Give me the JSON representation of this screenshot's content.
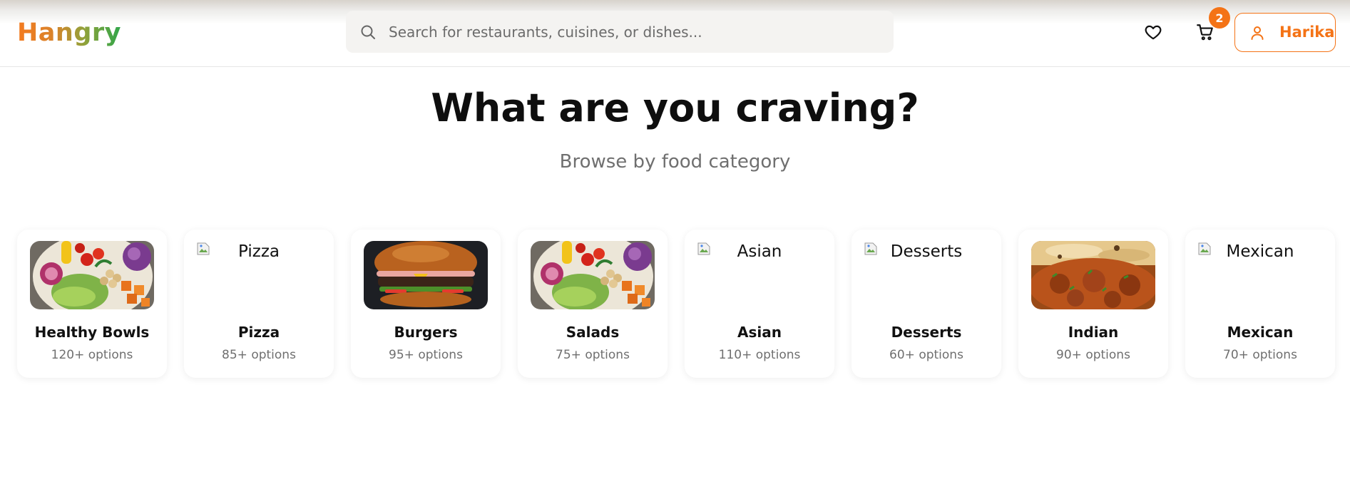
{
  "header": {
    "logo": "Hangry",
    "search_placeholder": "Search for restaurants, cuisines, or dishes...",
    "cart_count": "2",
    "user_name": "Harika"
  },
  "hero": {
    "title": "What are you craving?",
    "subtitle": "Browse by food category"
  },
  "categories": [
    {
      "name": "Healthy Bowls",
      "count": "120+ options",
      "image": "bowl"
    },
    {
      "name": "Pizza",
      "count": "85+ options",
      "image": "broken",
      "alt": "Pizza"
    },
    {
      "name": "Burgers",
      "count": "95+ options",
      "image": "burger"
    },
    {
      "name": "Salads",
      "count": "75+ options",
      "image": "bowl"
    },
    {
      "name": "Asian",
      "count": "110+ options",
      "image": "broken",
      "alt": "Asian"
    },
    {
      "name": "Desserts",
      "count": "60+ options",
      "image": "broken",
      "alt": "Desserts"
    },
    {
      "name": "Indian",
      "count": "90+ options",
      "image": "curry"
    },
    {
      "name": "Mexican",
      "count": "70+ options",
      "image": "broken",
      "alt": "Mexican"
    }
  ],
  "colors": {
    "accent": "#f47316",
    "logo_start": "#f47b20",
    "logo_end": "#2fa64a"
  },
  "icons": [
    "search-icon",
    "heart-icon",
    "cart-icon",
    "user-icon",
    "broken-image-icon"
  ]
}
